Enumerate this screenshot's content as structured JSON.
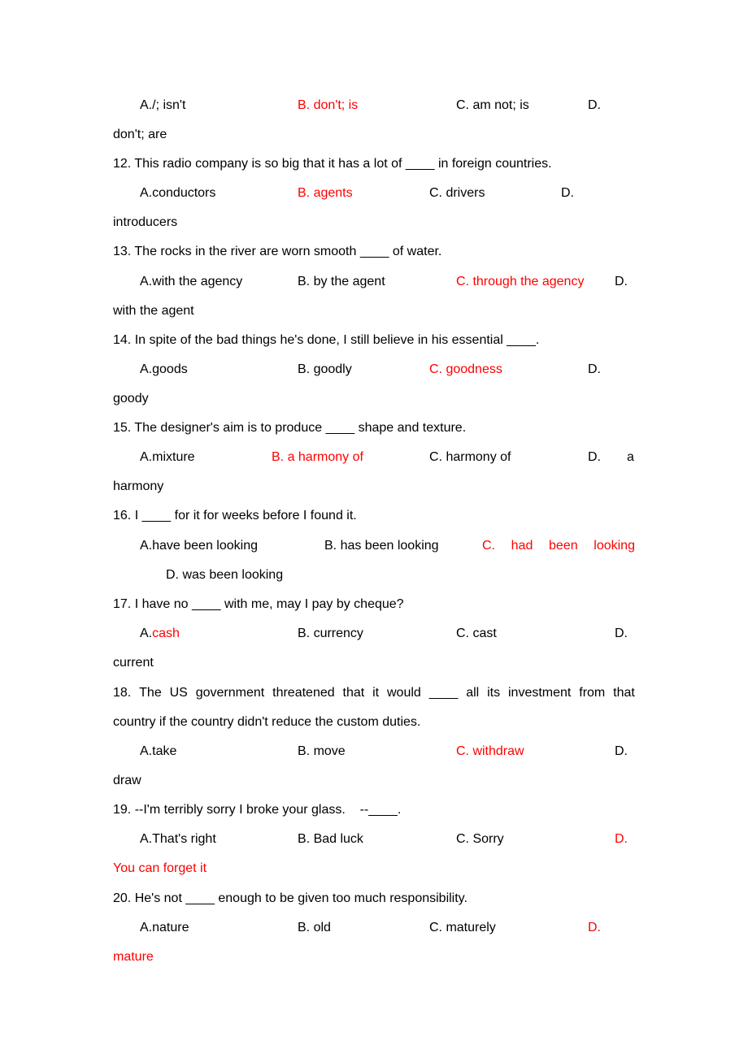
{
  "document": {
    "continued_q11": {
      "options": {
        "A": "A./; isn't",
        "B": "B. don't; is",
        "C": "C. am not; is",
        "D_prefix": "D.",
        "D_cont": "don't; are"
      },
      "answer": "B"
    },
    "questions": [
      {
        "number": "12",
        "stem": "12. This radio company is so big that it has a lot of ____ in foreign countries.",
        "options": {
          "A": "A.conductors",
          "B": "B. agents",
          "C": "C. drivers",
          "D_prefix": "D.",
          "D_cont": "introducers"
        },
        "answer": "B"
      },
      {
        "number": "13",
        "stem": "13. The rocks in the river are worn smooth ____ of water.",
        "options": {
          "A": "A.with the agency",
          "B": "B. by the agent",
          "C": "C. through the agency",
          "D_prefix": "D.",
          "D_cont": "with the agent"
        },
        "answer": "C"
      },
      {
        "number": "14",
        "stem": "14. In spite of the bad things he's done, I still believe in his essential ____.",
        "options": {
          "A": "A.goods",
          "B": "B. goodly",
          "C": "C. goodness",
          "D_prefix": "D.",
          "D_cont": "goody"
        },
        "answer": "C"
      },
      {
        "number": "15",
        "stem": "15. The designer's aim is to produce ____ shape and texture.",
        "options": {
          "A": "A.mixture",
          "B": "B. a harmony of",
          "C": "C. harmony of",
          "D_prefix": "D.",
          "D_word": "a",
          "D_cont": "harmony"
        },
        "answer": "B"
      },
      {
        "number": "16",
        "stem": "16. I ____ for it for weeks before I found it.",
        "options": {
          "A": "A.have been looking",
          "B": "B. has been looking",
          "C_words": [
            "C.",
            "had",
            "been",
            "looking"
          ],
          "D": "D. was been looking"
        },
        "answer": "C"
      },
      {
        "number": "17",
        "stem": "17. I have no ____ with me, may I pay by cheque?",
        "options": {
          "A_prefix": "A.",
          "A_word": "cash",
          "B": "B. currency",
          "C": "C. cast",
          "D_prefix": "D.",
          "D_cont": "current"
        },
        "answer": "A"
      },
      {
        "number": "18",
        "stem_line1_words": [
          "18.",
          "The",
          "US",
          "government",
          "threatened",
          "that",
          "it",
          "would",
          "____",
          "all",
          "its",
          "investment",
          "from",
          "that"
        ],
        "stem_line2": "country if the country didn't reduce the custom duties.",
        "options": {
          "A": "A.take",
          "B": "B. move",
          "C": "C. withdraw",
          "D_prefix": "D.",
          "D_cont": "draw"
        },
        "answer": "C"
      },
      {
        "number": "19",
        "stem": "19. --I'm terribly sorry I broke your glass.    --____.",
        "options": {
          "A": "A.That's right",
          "B": "B. Bad luck",
          "C": "C. Sorry",
          "D_prefix": "D.",
          "D_cont": "You can forget it"
        },
        "answer": "D"
      },
      {
        "number": "20",
        "stem": "20. He's not ____ enough to be given too much responsibility.",
        "options": {
          "A": "A.nature",
          "B": "B. old",
          "C": "C. maturely",
          "D_prefix": "D.",
          "D_cont": "mature"
        },
        "answer": "D"
      }
    ],
    "colors": {
      "text": "#000000",
      "answer": "#ff0000"
    }
  }
}
